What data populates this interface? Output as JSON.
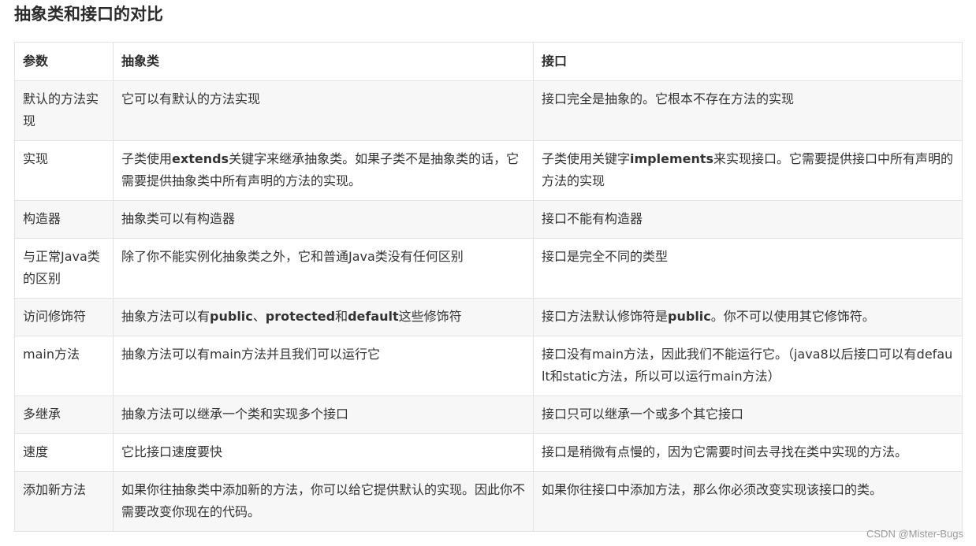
{
  "title": "抽象类和接口的对比",
  "table": {
    "headers": [
      "参数",
      "抽象类",
      "接口"
    ],
    "rows": [
      {
        "param": "默认的方法实现",
        "abstract": [
          {
            "t": "它可以有默认的方法实现"
          }
        ],
        "iface": [
          {
            "t": "接口完全是抽象的。它根本不存在方法的实现"
          }
        ]
      },
      {
        "param": "实现",
        "abstract": [
          {
            "t": "子类使用"
          },
          {
            "t": "extends",
            "b": true
          },
          {
            "t": "关键字来继承抽象类。如果子类不是抽象类的话，它需要提供抽象类中所有声明的方法的实现。"
          }
        ],
        "iface": [
          {
            "t": "子类使用关键字"
          },
          {
            "t": "implements",
            "b": true
          },
          {
            "t": "来实现接口。它需要提供接口中所有声明的方法的实现"
          }
        ]
      },
      {
        "param": "构造器",
        "abstract": [
          {
            "t": "抽象类可以有构造器"
          }
        ],
        "iface": [
          {
            "t": "接口不能有构造器"
          }
        ]
      },
      {
        "param": "与正常Java类的区别",
        "abstract": [
          {
            "t": "除了你不能实例化抽象类之外，它和普通Java类没有任何区别"
          }
        ],
        "iface": [
          {
            "t": "接口是完全不同的类型"
          }
        ]
      },
      {
        "param": "访问修饰符",
        "abstract": [
          {
            "t": "抽象方法可以有"
          },
          {
            "t": "public",
            "b": true
          },
          {
            "t": "、"
          },
          {
            "t": "protected",
            "b": true
          },
          {
            "t": "和"
          },
          {
            "t": "default",
            "b": true
          },
          {
            "t": "这些修饰符"
          }
        ],
        "iface": [
          {
            "t": "接口方法默认修饰符是"
          },
          {
            "t": "public",
            "b": true
          },
          {
            "t": "。你不可以使用其它修饰符。"
          }
        ]
      },
      {
        "param": "main方法",
        "abstract": [
          {
            "t": "抽象方法可以有main方法并且我们可以运行它"
          }
        ],
        "iface": [
          {
            "t": "接口没有main方法，因此我们不能运行它。（java8以后接口可以有default和static方法，所以可以运行main方法）"
          }
        ]
      },
      {
        "param": "多继承",
        "abstract": [
          {
            "t": "抽象方法可以继承一个类和实现多个接口"
          }
        ],
        "iface": [
          {
            "t": "接口只可以继承一个或多个其它接口"
          }
        ]
      },
      {
        "param": "速度",
        "abstract": [
          {
            "t": "它比接口速度要快"
          }
        ],
        "iface": [
          {
            "t": "接口是稍微有点慢的，因为它需要时间去寻找在类中实现的方法。"
          }
        ]
      },
      {
        "param": "添加新方法",
        "abstract": [
          {
            "t": "如果你往抽象类中添加新的方法，你可以给它提供默认的实现。因此你不需要改变你现在的代码。"
          }
        ],
        "iface": [
          {
            "t": "如果你往接口中添加方法，那么你必须改变实现该接口的类。"
          }
        ]
      }
    ]
  },
  "watermark": "CSDN @Mister-Bugs"
}
